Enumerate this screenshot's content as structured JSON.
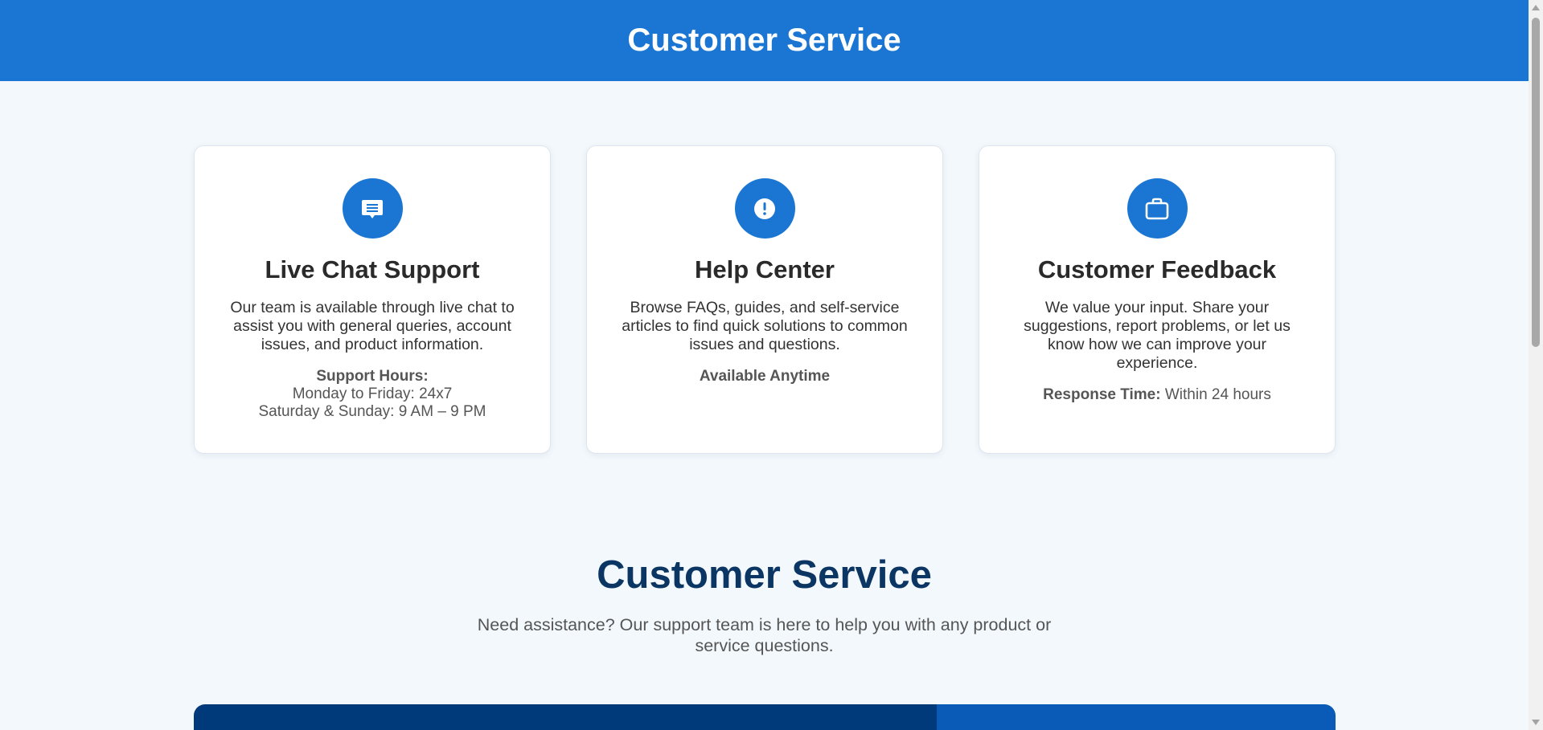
{
  "header": {
    "title": "Customer Service"
  },
  "cards": [
    {
      "icon": "chat-bubble-icon",
      "title": "Live Chat Support",
      "description": "Our team is available through live chat to assist you with general queries, account issues, and product information.",
      "meta_label": "Support Hours:",
      "meta_lines": [
        "Monday to Friday: 24x7",
        "Saturday & Sunday: 9 AM – 9 PM"
      ]
    },
    {
      "icon": "info-exclamation-icon",
      "title": "Help Center",
      "description": "Browse FAQs, guides, and self-service articles to find quick solutions to common issues and questions.",
      "meta_label": "Available Anytime"
    },
    {
      "icon": "briefcase-icon",
      "title": "Customer Feedback",
      "description": "We value your input. Share your suggestions, report problems, or let us know how we can improve your experience.",
      "meta_label": "Response Time:",
      "meta_value": "Within 24 hours"
    }
  ],
  "section": {
    "title": "Customer Service",
    "subtitle": "Need assistance? Our support team is here to help you with any product or service questions."
  },
  "colors": {
    "primary": "#1a76d2",
    "page_background": "#f3f8fc",
    "heading_dark": "#0b3563",
    "panel_dark": "#003a7a",
    "panel_light": "#0a5bb8"
  }
}
